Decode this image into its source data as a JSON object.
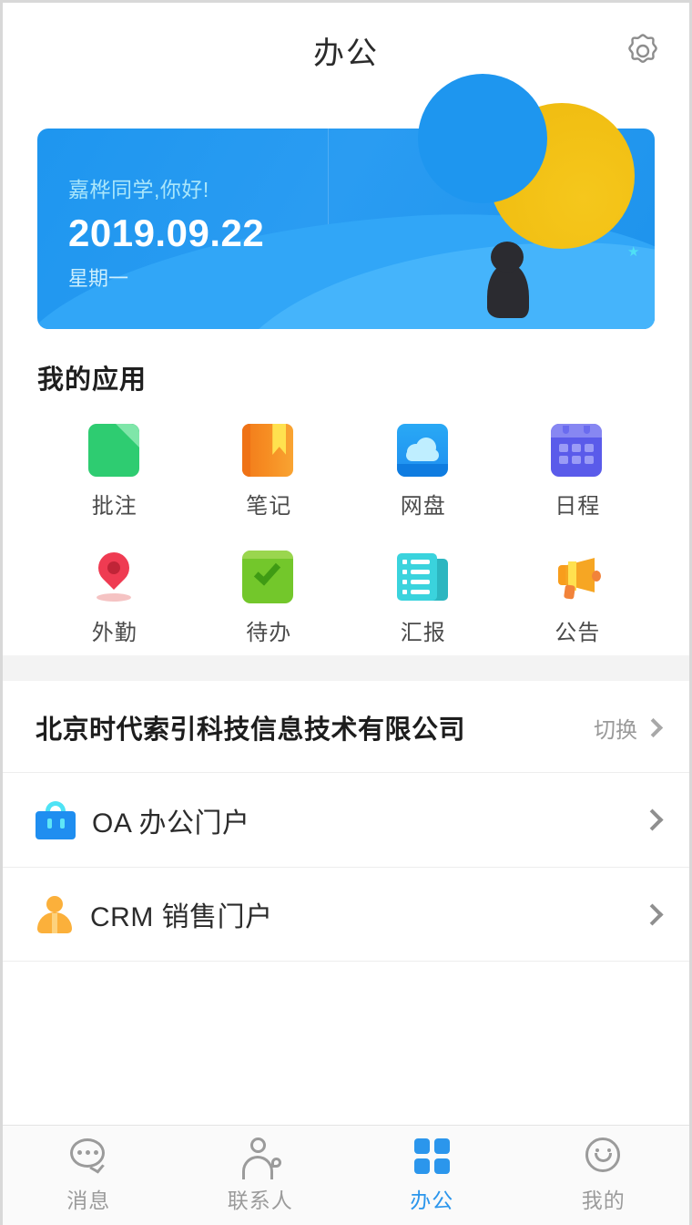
{
  "header": {
    "title": "办公",
    "settings_icon": "gear-icon"
  },
  "banner": {
    "greeting": "嘉桦同学,你好!",
    "date": "2019.09.22",
    "weekday": "星期一",
    "background_color": "#1e96ef",
    "moon_color": "#f2c014",
    "star_color": "#4fe0f5",
    "greeting_color": "#a9e6fb"
  },
  "my_apps": {
    "title": "我的应用",
    "items": [
      {
        "label": "批注",
        "icon": "annotation-icon",
        "color": "#2ecc71"
      },
      {
        "label": "笔记",
        "icon": "notebook-icon",
        "color": "#f68c22"
      },
      {
        "label": "网盘",
        "icon": "cloud-drive-icon",
        "color": "#1f8ef0"
      },
      {
        "label": "日程",
        "icon": "calendar-icon",
        "color": "#5a5bea"
      },
      {
        "label": "外勤",
        "icon": "location-pin-icon",
        "color": "#ef3b52"
      },
      {
        "label": "待办",
        "icon": "checkmark-icon",
        "color": "#73c72b"
      },
      {
        "label": "汇报",
        "icon": "report-list-icon",
        "color": "#3ad3dd"
      },
      {
        "label": "公告",
        "icon": "megaphone-icon",
        "color": "#f6a623"
      }
    ]
  },
  "company": {
    "name": "北京时代索引科技信息技术有限公司",
    "switch_label": "切换",
    "portals": [
      {
        "label": "OA 办公门户",
        "icon": "briefcase-icon"
      },
      {
        "label": "CRM 销售门户",
        "icon": "person-icon"
      }
    ]
  },
  "tabbar": {
    "active_color": "#2b96ec",
    "inactive_color": "#9b9b9b",
    "tabs": [
      {
        "label": "消息",
        "icon": "chat-bubble-icon",
        "active": false
      },
      {
        "label": "联系人",
        "icon": "contacts-icon",
        "active": false
      },
      {
        "label": "办公",
        "icon": "grid-icon",
        "active": true
      },
      {
        "label": "我的",
        "icon": "smiley-icon",
        "active": false
      }
    ]
  }
}
